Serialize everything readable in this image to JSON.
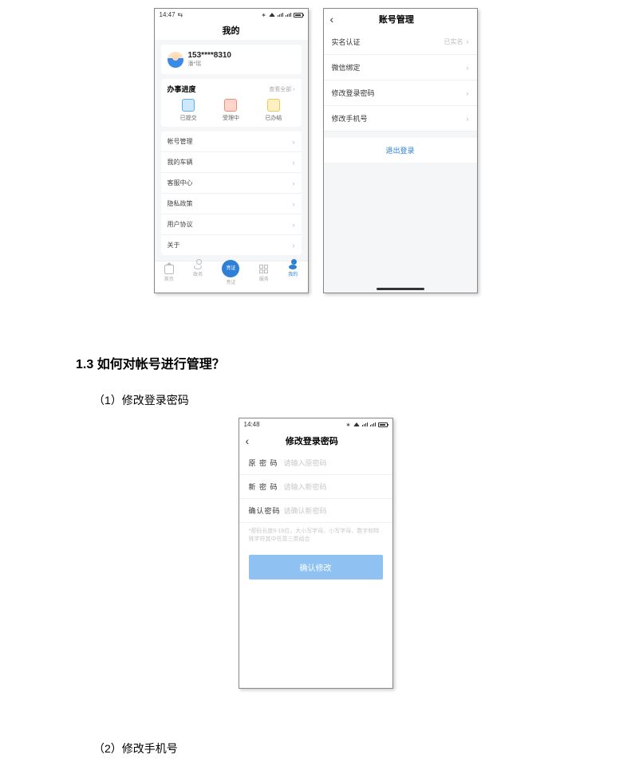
{
  "phoneA": {
    "status_time": "14:47",
    "carrier_glyph": "⇆",
    "title": "我的",
    "user": {
      "phone": "153****8310",
      "name": "潘*瑶"
    },
    "progress": {
      "title": "办事进度",
      "more": "查看全部 ›",
      "items": [
        "已提交",
        "受理中",
        "已办结"
      ]
    },
    "menu": [
      "帐号管理",
      "我的车辆",
      "客服中心",
      "隐私政策",
      "用户协议",
      "关于"
    ],
    "tabs": [
      "首页",
      "政务",
      "亮证",
      "服务",
      "我的"
    ],
    "tab_big_text": "亮证"
  },
  "phoneB": {
    "title": "账号管理",
    "items": [
      {
        "label": "实名认证",
        "value": "已实名"
      },
      {
        "label": "微信绑定",
        "value": ""
      },
      {
        "label": "修改登录密码",
        "value": ""
      },
      {
        "label": "修改手机号",
        "value": ""
      }
    ],
    "logout": "退出登录"
  },
  "doc": {
    "heading": "1.3 如何对帐号进行管理？",
    "step1": "（1）修改登录密码",
    "step2": "（2）修改手机号"
  },
  "phoneC": {
    "status_time": "14:48",
    "title": "修改登录密码",
    "fields": [
      {
        "label": "原 密 码",
        "placeholder": "请输入原密码"
      },
      {
        "label": "新 密 码",
        "placeholder": "请输入新密码"
      },
      {
        "label": "确认密码",
        "placeholder": "请确认新密码"
      }
    ],
    "hint": "*密码长度8-16位，大小写字母、小写字母、数字和特殊字符其中任意三类组合",
    "button": "确认修改"
  }
}
